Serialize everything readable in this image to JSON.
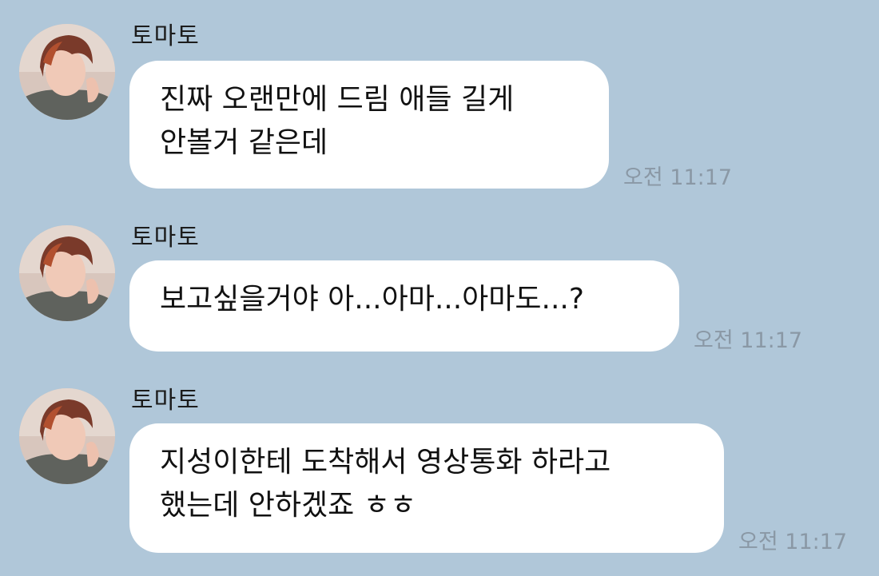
{
  "messages": [
    {
      "sender": "토마토",
      "lines": [
        "진짜 오랜만에 드림 애들 길게",
        "안볼거 같은데"
      ],
      "time": "오전 11:17"
    },
    {
      "sender": "토마토",
      "lines": [
        "보고싶을거야 아...아마...아마도...?"
      ],
      "time": "오전 11:17"
    },
    {
      "sender": "토마토",
      "lines": [
        "지성이한테 도착해서 영상통화 하라고",
        "했는데 안하겠죠 ㅎㅎ"
      ],
      "time": "오전 11:17"
    }
  ],
  "avatar_icon": "profile-photo",
  "colors": {
    "background": "#b0c7d9",
    "bubble": "#ffffff",
    "timestamp": "#8a98a5"
  }
}
